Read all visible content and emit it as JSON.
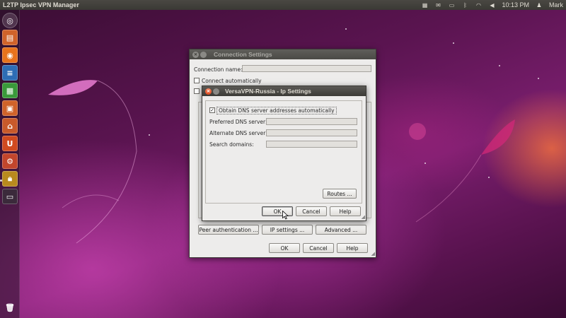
{
  "top_panel": {
    "app_title": "L2TP Ipsec VPN Manager",
    "clock": "10:13 PM",
    "user": "Mark",
    "tray_icons": [
      "network-icon",
      "mail-icon",
      "battery-icon",
      "bluetooth-icon",
      "wifi-icon",
      "volume-icon",
      "user-icon"
    ]
  },
  "launcher": {
    "items": [
      "dash-icon",
      "files-icon",
      "firefox-icon",
      "writer-icon",
      "calc-icon",
      "impress-icon",
      "software-center-icon",
      "ubuntu-one-icon",
      "settings-icon",
      "vpn-lock-icon",
      "workspace-icon",
      "trash-icon"
    ]
  },
  "connection_settings": {
    "title": "Connection Settings",
    "connection_name_label": "Connection name:",
    "connection_name_value": "",
    "connect_auto_label": "Connect automatically",
    "peer_auth_button": "Peer authentication ...",
    "ip_settings_button": "IP settings ...",
    "advanced_button": "Advanced ...",
    "ok_button": "OK",
    "cancel_button": "Cancel",
    "help_button": "Help"
  },
  "ip_settings": {
    "title": "VersaVPN-Russia - Ip Settings",
    "obtain_dns_label": "Obtain DNS server addresses automatically",
    "obtain_dns_checked": "✓",
    "preferred_dns_label": "Preferred DNS server:",
    "alternate_dns_label": "Alternate DNS server:",
    "search_domains_label": "Search domains:",
    "routes_button": "Routes ...",
    "ok_button": "OK",
    "cancel_button": "Cancel",
    "help_button": "Help"
  }
}
